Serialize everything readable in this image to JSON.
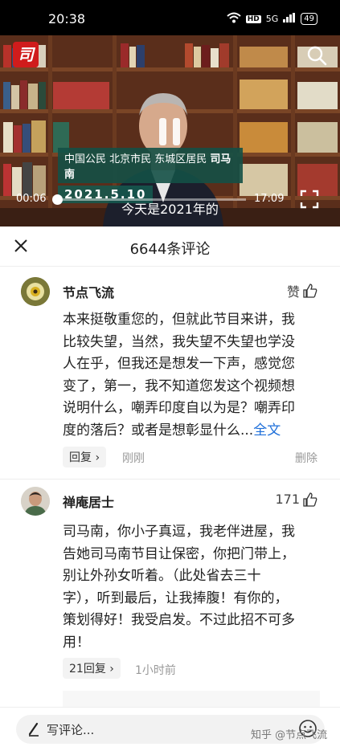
{
  "status_bar": {
    "time": "20:38",
    "hd_label": "HD",
    "signal_label": "5G",
    "battery": "49"
  },
  "video": {
    "caption_line1_prefix": "中国公民 北京市民 东城区居民",
    "caption_name": "司马南",
    "caption_date": "2021.5.10",
    "subtitle": "今天是2021年的",
    "current_time": "00:06",
    "total_time": "17:09",
    "progress_fraction": 0.006,
    "logo_char": "司"
  },
  "comments_header": {
    "title": "6644条评论"
  },
  "comments": [
    {
      "username": "节点飞流",
      "like_label": "赞",
      "lines": [
        "本来挺敬重您的，但就此节目来讲，我",
        "比较失望，当然，我失望不失望也学没",
        "人在乎，但我还是想发一下声，感觉您",
        "变了，第一，我不知道您发这个视频想",
        "说明什么，嘲弄印度自以为是？嘲弄印",
        "度的落后？或者是想彰显什么..."
      ],
      "more_label": "全文",
      "reply_label": "回复",
      "time": "刚刚",
      "delete_label": "删除"
    },
    {
      "username": "禅庵居士",
      "like_label": "171",
      "lines": [
        "司马南，你小子真逗，我老伴进屋，我",
        "告她司马南节目让保密，你把门带上，",
        "别让外孙女听着。（此处省去三十",
        "字），听到最后，让我捧腹！有你的，",
        "策划得好！我受启发。不过此招不可多",
        "用！"
      ],
      "reply_label": "21回复",
      "time": "1小时前"
    }
  ],
  "input_bar": {
    "placeholder": "写评论...",
    "watermark": "知乎 @节点飞流"
  },
  "colors": {
    "link": "#1e6fd9",
    "caption_bg": "#145046",
    "background": "#ffffff"
  }
}
